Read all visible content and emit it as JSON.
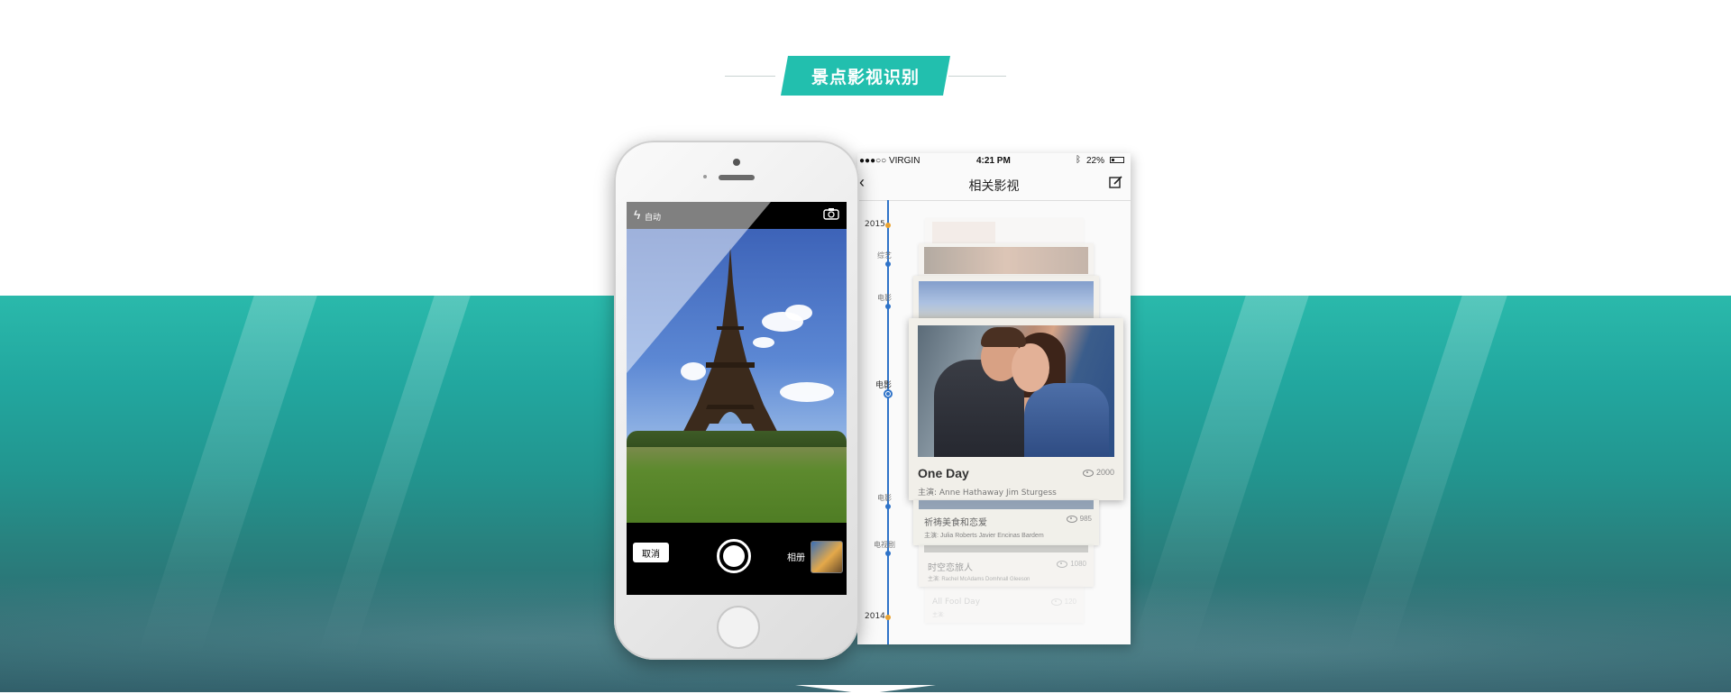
{
  "section": {
    "title": "景点影视识别"
  },
  "camera_app": {
    "flash_mode": "自动",
    "cancel_label": "取消",
    "album_label": "相册"
  },
  "timeline_app": {
    "status_bar": {
      "carrier": "●●●○○ VIRGIN",
      "time": "4:21 PM",
      "battery": "22%"
    },
    "nav_title": "相关影视",
    "timeline": {
      "year_top": "2015",
      "year_bottom": "2014",
      "labels": [
        "综艺",
        "电影",
        "电影",
        "电影",
        "电视剧"
      ]
    },
    "featured": {
      "title": "One Day",
      "views": "2000",
      "stars": "主演:  Anne Hathaway    Jim Sturgess"
    },
    "list": [
      {
        "title": "祈祷美食和恋爱",
        "views": "985",
        "stars": "主演:  Julia Roberts    Javier Encinas Bardem"
      },
      {
        "title": "时空恋旅人",
        "views": "1080",
        "stars": "主演:  Rachel McAdams    Domhnall Gleeson"
      },
      {
        "title": "All Fool Day",
        "views": "120",
        "stars": "主演:"
      }
    ]
  },
  "colors": {
    "accent": "#22bfae",
    "timeline": "#2f73c8",
    "year_dot": "#e9a332"
  }
}
